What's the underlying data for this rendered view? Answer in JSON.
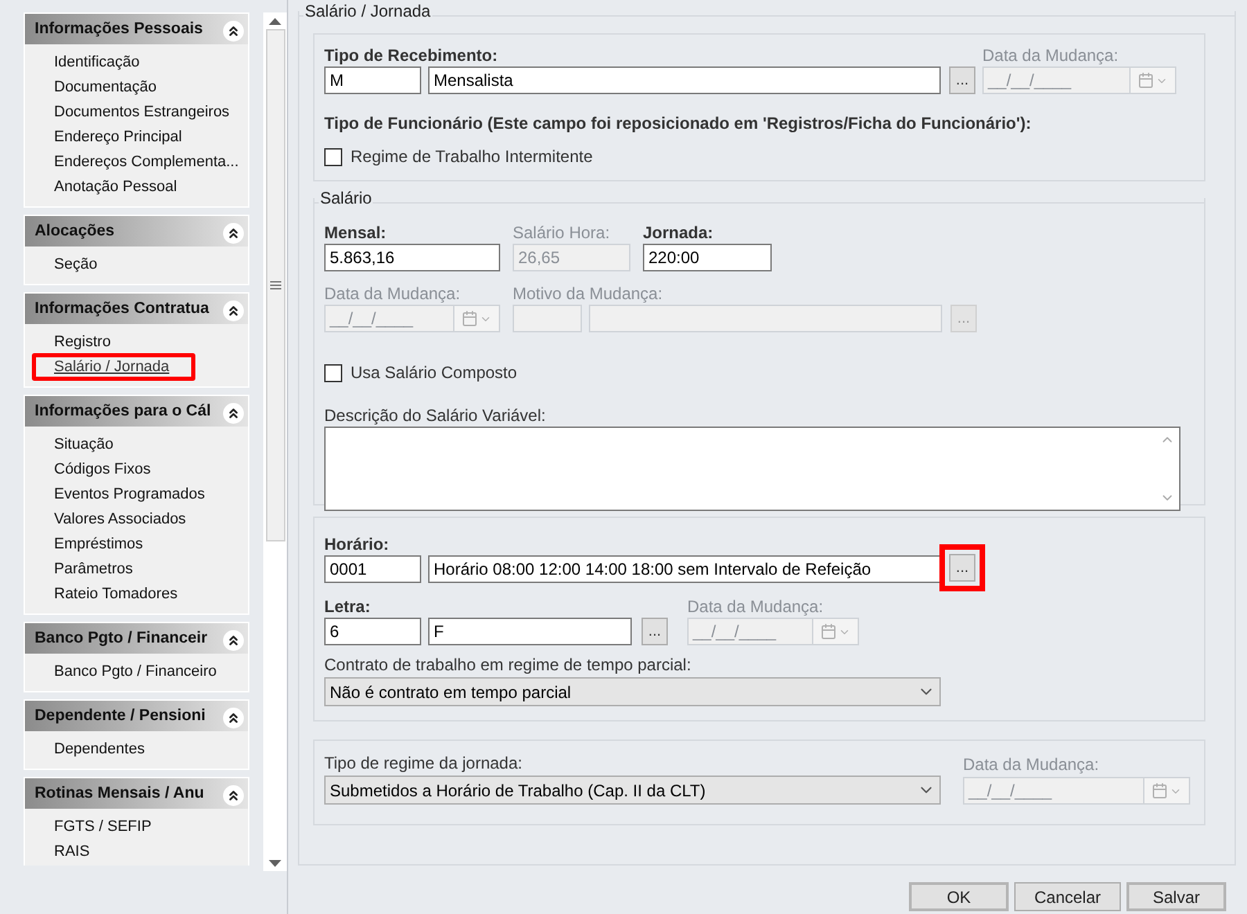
{
  "sidebar": {
    "sections": [
      {
        "title": "Informações Pessoais",
        "items": [
          {
            "label": "Identificação",
            "selected": false,
            "highlighted": false
          },
          {
            "label": "Documentação",
            "selected": false,
            "highlighted": false
          },
          {
            "label": "Documentos Estrangeiros",
            "selected": false,
            "highlighted": false
          },
          {
            "label": "Endereço Principal",
            "selected": false,
            "highlighted": false
          },
          {
            "label": "Endereços Complementa...",
            "selected": false,
            "highlighted": false
          },
          {
            "label": "Anotação Pessoal",
            "selected": false,
            "highlighted": false
          }
        ]
      },
      {
        "title": "Alocações",
        "items": [
          {
            "label": "Seção",
            "selected": false,
            "highlighted": false
          }
        ]
      },
      {
        "title": "Informações Contratua",
        "items": [
          {
            "label": "Registro",
            "selected": false,
            "highlighted": false
          },
          {
            "label": "Salário / Jornada",
            "selected": true,
            "highlighted": true
          }
        ]
      },
      {
        "title": "Informações para o Cál",
        "items": [
          {
            "label": "Situação",
            "selected": false,
            "highlighted": false
          },
          {
            "label": "Códigos Fixos",
            "selected": false,
            "highlighted": false
          },
          {
            "label": "Eventos Programados",
            "selected": false,
            "highlighted": false
          },
          {
            "label": "Valores Associados",
            "selected": false,
            "highlighted": false
          },
          {
            "label": "Empréstimos",
            "selected": false,
            "highlighted": false
          },
          {
            "label": "Parâmetros",
            "selected": false,
            "highlighted": false
          },
          {
            "label": "Rateio Tomadores",
            "selected": false,
            "highlighted": false
          }
        ]
      },
      {
        "title": "Banco Pgto / Financeir",
        "items": [
          {
            "label": "Banco Pgto / Financeiro",
            "selected": false,
            "highlighted": false
          }
        ]
      },
      {
        "title": "Dependente / Pensioni",
        "items": [
          {
            "label": "Dependentes",
            "selected": false,
            "highlighted": false
          }
        ]
      },
      {
        "title": "Rotinas Mensais / Anu",
        "items": [
          {
            "label": "FGTS / SEFIP",
            "selected": false,
            "highlighted": false
          },
          {
            "label": "RAIS",
            "selected": false,
            "highlighted": false
          }
        ]
      }
    ]
  },
  "form": {
    "title": "Salário / Jornada",
    "recebimento": {
      "label": "Tipo de Recebimento:",
      "code": "M",
      "description": "Mensalista",
      "date_label": "Data da Mudança:",
      "date_value": "__/__/____",
      "button": "..."
    },
    "funcionario_note": "Tipo de Funcionário (Este campo foi reposicionado em 'Registros/Ficha do Funcionário'):",
    "intermitente": {
      "label": "Regime de Trabalho Intermitente",
      "checked": false
    },
    "salario": {
      "title": "Salário",
      "fields": [
        {
          "label": "Mensal:",
          "value": "5.863,16",
          "required": true,
          "disabled": false
        },
        {
          "label": "Salário Hora:",
          "value": "26,65",
          "required": false,
          "disabled": true
        },
        {
          "label": "Jornada:",
          "value": "220:00",
          "required": true,
          "disabled": false
        }
      ],
      "date_label": "Data da Mudança:",
      "date_value": "__/__/____",
      "motivo_label": "Motivo da Mudança:",
      "motivo_button": "...",
      "composto": {
        "label": "Usa Salário Composto",
        "checked": false
      },
      "descricao_label": "Descrição do Salário Variável:"
    },
    "horario": {
      "label": "Horário:",
      "code": "0001",
      "description": "Horário 08:00 12:00 14:00 18:00 sem Intervalo de Refeição",
      "button": "...",
      "highlighted": true
    },
    "letra": {
      "label": "Letra:",
      "code": "6",
      "value": "F",
      "button": "...",
      "date_label": "Data da Mudança:",
      "date_value": "__/__/____"
    },
    "contrato": {
      "label": "Contrato de trabalho em regime de tempo parcial:",
      "value": "Não é contrato em tempo parcial"
    },
    "regime": {
      "label": "Tipo de regime da jornada:",
      "value": "Submetidos a Horário de Trabalho (Cap. II da CLT)",
      "date_label": "Data da Mudança:",
      "date_value": "__/__/____"
    }
  },
  "buttons": [
    {
      "label": "OK",
      "kind": "default"
    },
    {
      "label": "Cancelar",
      "kind": "normal"
    },
    {
      "label": "Salvar",
      "kind": "default"
    }
  ]
}
